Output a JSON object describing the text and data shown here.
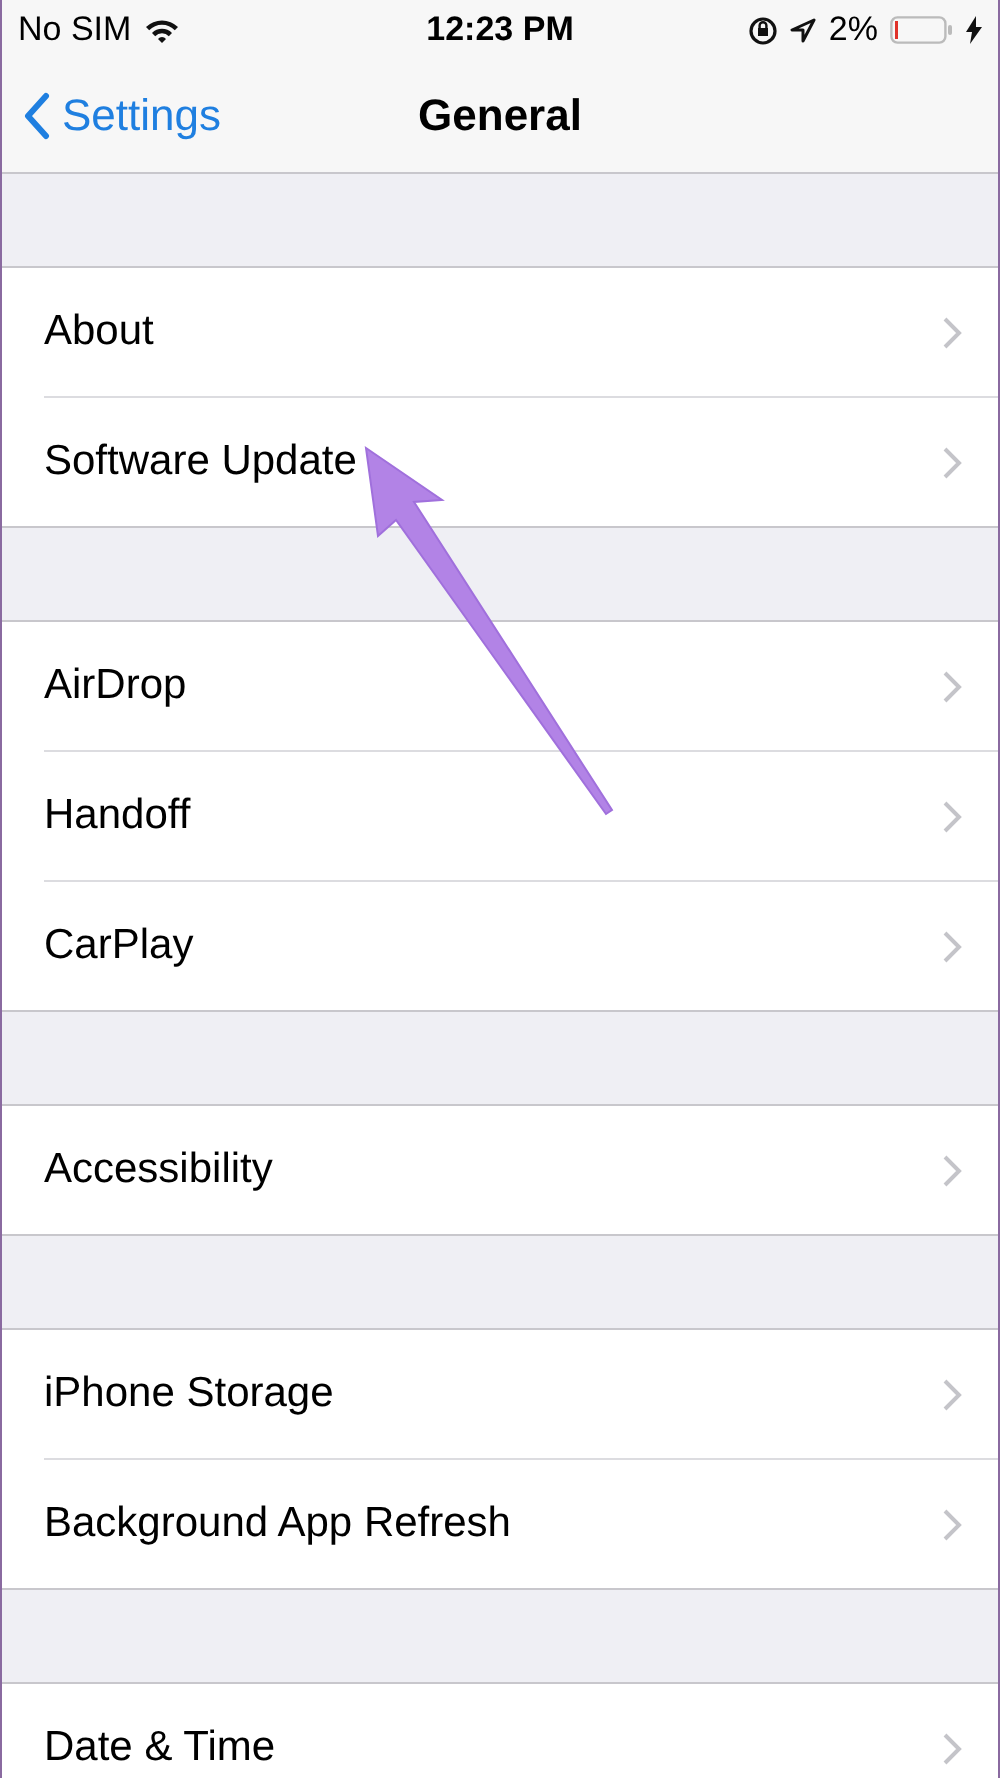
{
  "status_bar": {
    "carrier": "No SIM",
    "time": "12:23 PM",
    "battery": "2%"
  },
  "nav": {
    "back": "Settings",
    "title": "General"
  },
  "groups": [
    {
      "rows": [
        {
          "label": "About"
        },
        {
          "label": "Software Update"
        }
      ]
    },
    {
      "rows": [
        {
          "label": "AirDrop"
        },
        {
          "label": "Handoff"
        },
        {
          "label": "CarPlay"
        }
      ]
    },
    {
      "rows": [
        {
          "label": "Accessibility"
        }
      ]
    },
    {
      "rows": [
        {
          "label": "iPhone Storage"
        },
        {
          "label": "Background App Refresh"
        }
      ]
    },
    {
      "rows": [
        {
          "label": "Date & Time"
        }
      ]
    }
  ]
}
